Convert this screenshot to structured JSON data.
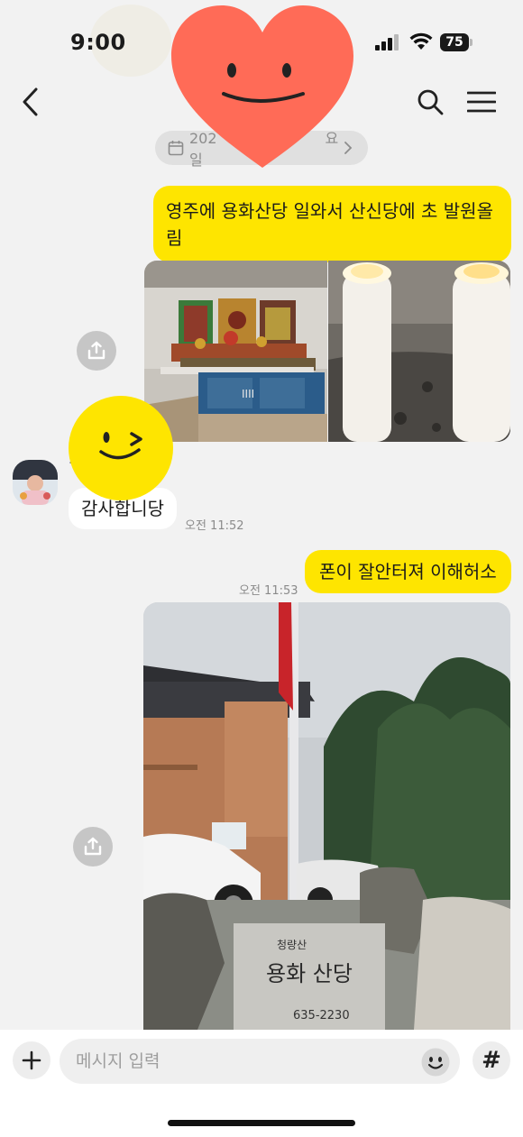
{
  "status_bar": {
    "time": "9:00",
    "battery": "75"
  },
  "date_divider": {
    "text": "202",
    "suffix": "요일"
  },
  "messages": [
    {
      "side": "me",
      "text": "영주에 용화산당 일와서 산신당에 초 발원올림"
    },
    {
      "side": "other",
      "sender_obscured": "·",
      "text": "감사합니당",
      "time": "오전 11:52"
    },
    {
      "side": "me",
      "text": "폰이 잘안터져 이해허소",
      "time": "오전 11:53"
    }
  ],
  "photo_signs": {
    "altar_board": "IIII",
    "stone_small": "청량산",
    "stone_main": "용화 산당",
    "stone_phone": "635-2230"
  },
  "input": {
    "placeholder": "메시지 입력"
  },
  "buttons": {
    "hash": "#"
  },
  "colors": {
    "my_bubble": "#fee500",
    "other_bubble": "#ffffff",
    "background": "#f2f2f2"
  },
  "icons": [
    "back-arrow-icon",
    "search-icon",
    "menu-icon",
    "calendar-icon",
    "share-icon",
    "plus-icon",
    "emoji-icon",
    "heart-sticker",
    "smiley-sticker"
  ]
}
